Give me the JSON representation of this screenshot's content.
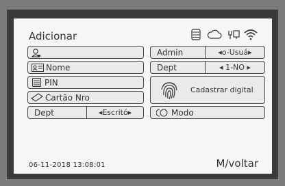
{
  "header": {
    "title": "Adicionar",
    "icons": [
      "storage-icon",
      "cloud-icon",
      "usb-icon",
      "wifi-icon"
    ]
  },
  "left": {
    "user_label": "",
    "name_label": "Nome",
    "pin_label": "PIN",
    "card_label": "Cartão Nro",
    "dept_label": "Dept",
    "dept_value": "◂Escritó▸"
  },
  "right": {
    "admin_label": "Admin",
    "admin_value": "◂o-Usuá▸",
    "dept_label": "Dept",
    "dept_value": "◂ 1-NO ▸",
    "fingerprint_label": "Cadastrar digital",
    "mode_label": "Modo"
  },
  "footer": {
    "datetime": "06-11-2018  13:08:01",
    "back_label": "M/voltar"
  }
}
